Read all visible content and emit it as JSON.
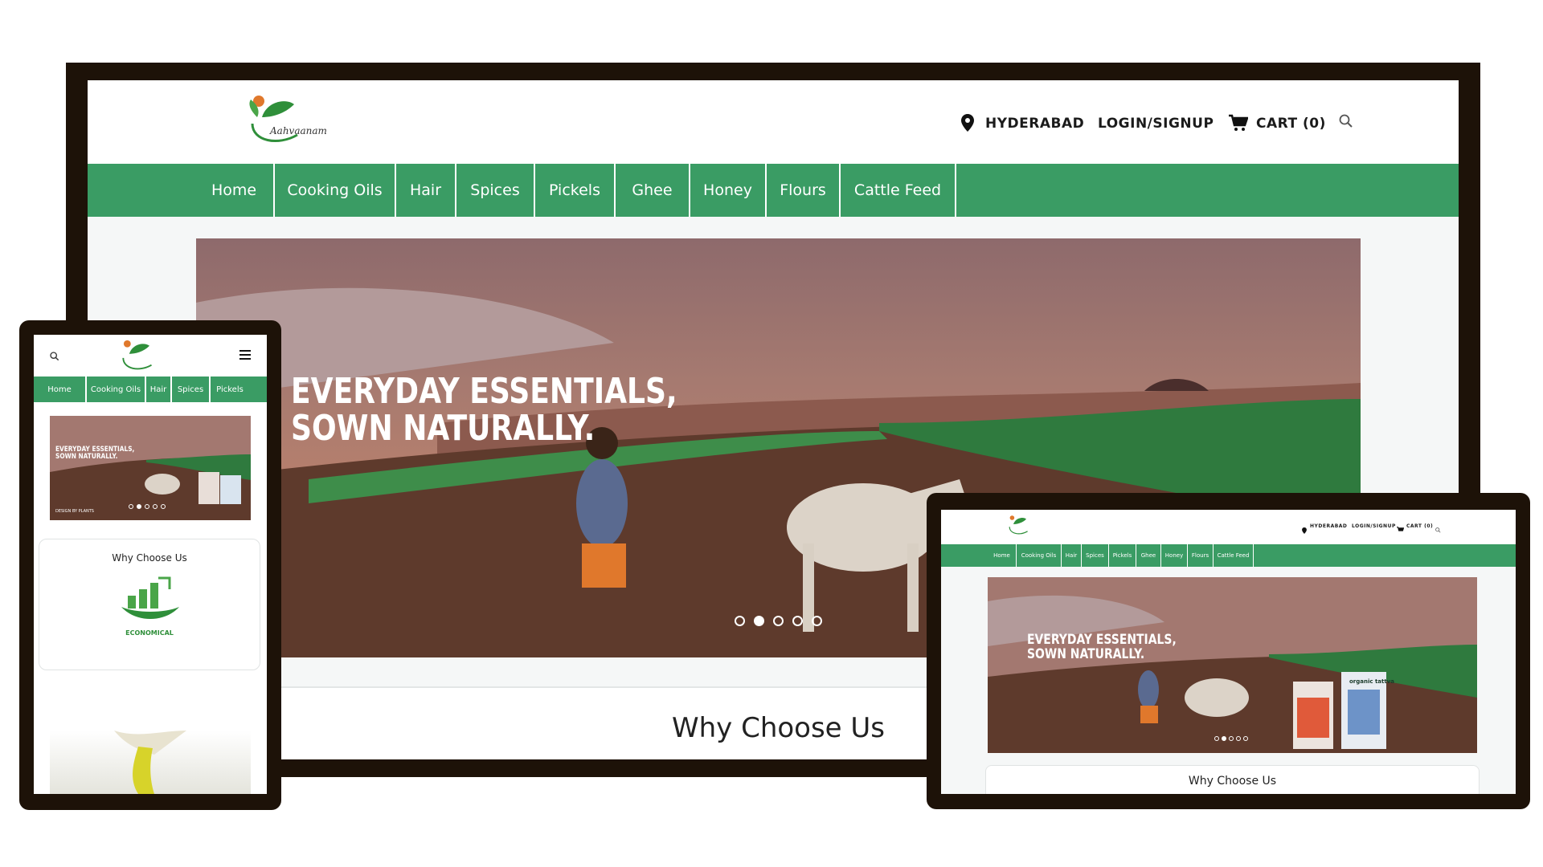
{
  "site": {
    "logo_text": "Aahvaanam",
    "location": "HYDERABAD",
    "login": "LOGIN/SIGNUP",
    "cart": "CART (0)",
    "nav": [
      "Home",
      "Cooking Oils",
      "Hair",
      "Spices",
      "Pickels",
      "Ghee",
      "Honey",
      "Flours",
      "Cattle Feed"
    ],
    "hero_line1": "EVERYDAY ESSENTIALS,",
    "hero_line2": "SOWN NATURALLY.",
    "section_title": "Why Choose Us",
    "feature_label": "ECONOMICAL",
    "slider_dots": 5,
    "active_slide": 2,
    "product_brand": "organic tattva",
    "small_caption": "DESIGN BY PLANTS"
  },
  "icons": {
    "location": "map-pin-icon",
    "cart": "cart-icon",
    "search": "search-icon",
    "menu": "hamburger-menu-icon",
    "feature": "economical-growth-icon"
  },
  "colors": {
    "nav_green": "#3a9c64",
    "device_frame": "#1d1208",
    "logo_green": "#2f8f3a",
    "logo_orange": "#e0782c"
  }
}
